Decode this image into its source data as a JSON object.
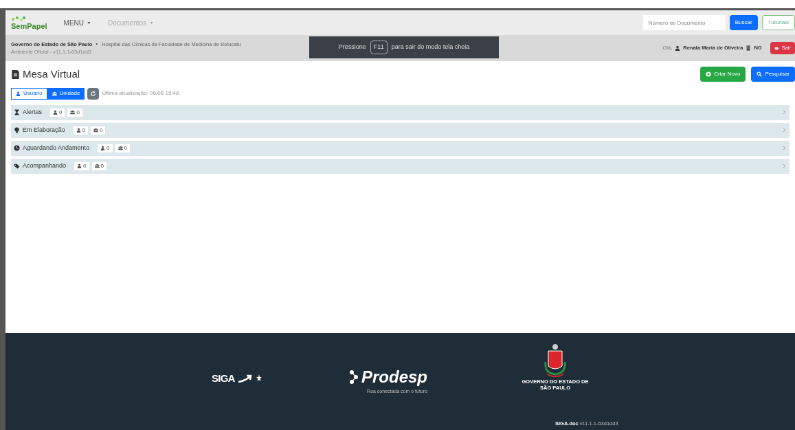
{
  "navbar": {
    "logo": "SemPapel",
    "menus": [
      {
        "label": "MENU",
        "disabled": false
      },
      {
        "label": "Documentos",
        "disabled": true
      }
    ],
    "search": {
      "placeholder": "Número de Documento"
    },
    "search_button": "Buscar",
    "tutorials_button": "Tutoriais"
  },
  "breadcrumb": {
    "org": "Governo do Estado de São Paulo",
    "unit": "Hospital das Clínicas da Faculdade de Medicina de Botucatu",
    "environment": "Ambiente Oficial - v11.1.1-63d1dd3"
  },
  "user": {
    "greeting": "Olá,",
    "name": "Renata Maria de Oliveira",
    "sigla": "NO",
    "logout": "Sair"
  },
  "fullscreen_notice": {
    "before": "Pressione",
    "key": "F11",
    "after": "para sair do modo tela cheia"
  },
  "page": {
    "title": "Mesa Virtual",
    "create_button": "Criar Novo",
    "search_button": "Pesquisar"
  },
  "filters": [
    {
      "label": "Usuário",
      "selected": false
    },
    {
      "label": "Unidade",
      "selected": true
    }
  ],
  "last_update": "Última atualização: 06/05 15:48",
  "sections": [
    {
      "kind": "hourglass",
      "title": "Alertas",
      "user_count": "0",
      "unit_count": "0"
    },
    {
      "kind": "lightbulb",
      "title": "Em Elaboração",
      "user_count": "0",
      "unit_count": "0"
    },
    {
      "kind": "clock",
      "title": "Aguardando Andamento",
      "user_count": "0",
      "unit_count": "0"
    },
    {
      "kind": "tags",
      "title": "Acompanhando",
      "user_count": "0",
      "unit_count": "0"
    }
  ],
  "footer": {
    "siga": "SIGA",
    "prodesp": "Prodesp",
    "prodesp_tagline": "Rua conectada com o futuro",
    "government": "GOVERNO DO ESTADO DE SÃO PAULO",
    "product": "SIGA.doc",
    "version": "v11.1.1-63d1dd3"
  }
}
